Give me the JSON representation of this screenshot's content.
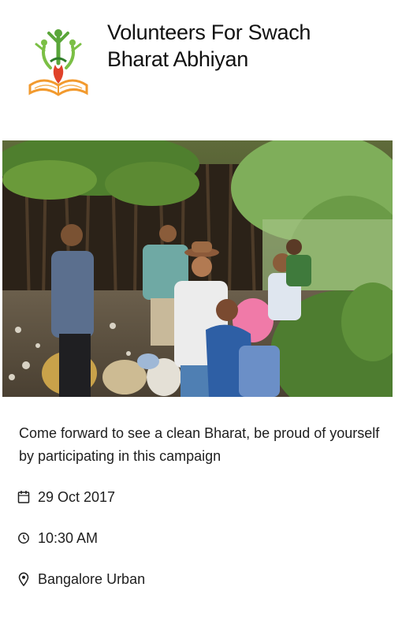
{
  "organization": {
    "name": "Volunteers For Swach Bharat Abhiyan",
    "logo_icon": "volunteers-book-logo-icon"
  },
  "hero": {
    "image": "volunteers-group-photo"
  },
  "event": {
    "description": "Come forward to see a clean Bharat, be proud of yourself by participating in this campaign",
    "date": "29 Oct 2017",
    "date_icon": "calendar-icon",
    "time": "10:30 AM",
    "time_icon": "clock-icon",
    "location": "Bangalore Urban",
    "location_icon": "map-pin-icon"
  },
  "colors": {
    "logo_green": "#5aa63a",
    "logo_orange": "#f29a2e",
    "logo_red": "#e0422a",
    "text": "#1e1e1e"
  }
}
